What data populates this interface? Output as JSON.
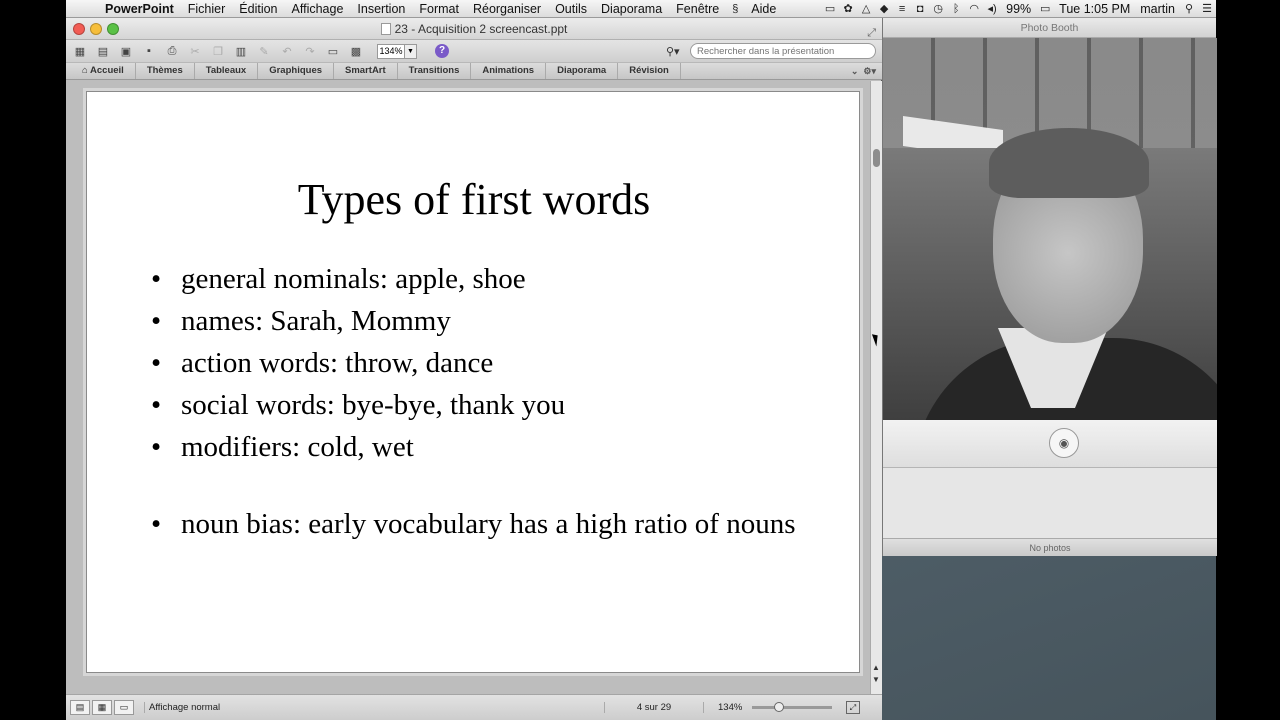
{
  "menubar": {
    "items": [
      "PowerPoint",
      "Fichier",
      "Édition",
      "Affichage",
      "Insertion",
      "Format",
      "Réorganiser",
      "Outils",
      "Diaporama",
      "Fenêtre",
      "Aide"
    ],
    "battery": "99%",
    "clock": "Tue 1:05 PM",
    "user": "martin"
  },
  "window": {
    "title": "23 - Acquisition 2 screencast.ppt",
    "zoom": "134%",
    "search_placeholder": "Rechercher dans la présentation"
  },
  "ribbon": {
    "tabs": [
      "Accueil",
      "Thèmes",
      "Tableaux",
      "Graphiques",
      "SmartArt",
      "Transitions",
      "Animations",
      "Diaporama",
      "Révision"
    ]
  },
  "slide": {
    "title": "Types of first words",
    "bullets": [
      "general nominals: apple, shoe",
      "names: Sarah, Mommy",
      "action words: throw, dance",
      "social words: bye-bye, thank you",
      "modifiers: cold, wet",
      "noun bias: early vocabulary has a high ratio of nouns"
    ]
  },
  "status": {
    "view": "Affichage normal",
    "page": "4 sur 29",
    "zoom": "134%"
  },
  "photobooth": {
    "title": "Photo Booth",
    "status": "No photos"
  }
}
